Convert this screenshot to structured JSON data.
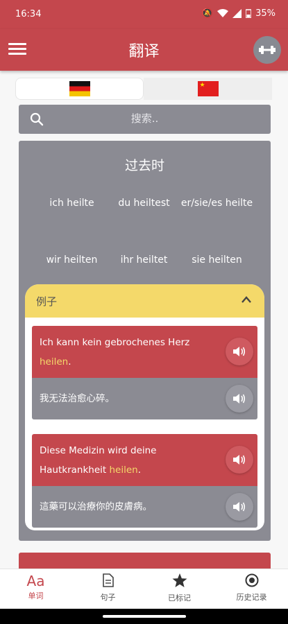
{
  "status": {
    "time": "16:34",
    "battery": "35%"
  },
  "appbar": {
    "title": "翻译"
  },
  "search": {
    "placeholder": "搜索.."
  },
  "conjugation": {
    "tense": "过去时",
    "forms": [
      "ich heilte",
      "du heiltest",
      "er/sie/es heilte",
      "wir heilten",
      "ihr heiltet",
      "sie heilten"
    ]
  },
  "examples": {
    "header": "例子",
    "items": [
      {
        "de_before": "Ich kann kein gebrochenes Herz ",
        "de_highlight": "heilen",
        "de_after": ".",
        "zh": "我无法治愈心碎。"
      },
      {
        "de_before": "Diese Medizin wird deine Hautkrankheit ",
        "de_highlight": "heilen",
        "de_after": ".",
        "zh": "這藥可以治療你的皮膚病。"
      }
    ]
  },
  "nav": {
    "items": [
      {
        "label": "单词",
        "icon": "Aa"
      },
      {
        "label": "句子",
        "icon": "document-icon"
      },
      {
        "label": "已标记",
        "icon": "star-icon"
      },
      {
        "label": "历史记录",
        "icon": "history-icon"
      }
    ]
  },
  "colors": {
    "primary": "#c4474d",
    "panel": "#8b8b93",
    "accent": "#f4d96a"
  }
}
